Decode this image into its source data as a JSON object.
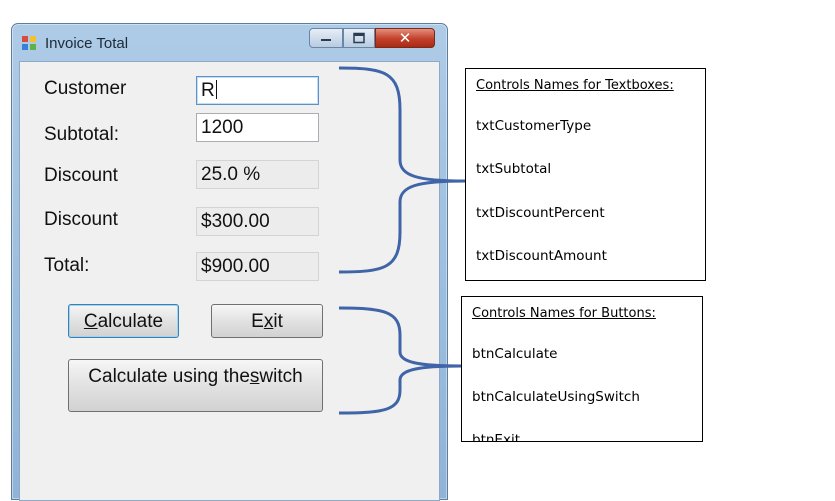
{
  "window": {
    "title": "Invoice Total",
    "close_glyph": "✕"
  },
  "form": {
    "customer_label": "Customer",
    "customer_value": "R",
    "subtotal_label": "Subtotal:",
    "subtotal_value": "1200",
    "discount_percent_label": "Discount",
    "discount_percent_value": "25.0 %",
    "discount_amount_label": "Discount",
    "discount_amount_value": "$300.00",
    "total_label": "Total:",
    "total_value": "$900.00"
  },
  "buttons": {
    "calculate": {
      "mnemonic": "C",
      "rest": "alculate"
    },
    "exit": {
      "before": "E",
      "mnemonic": "x",
      "after": "it"
    },
    "switch": {
      "before": "Calculate using the ",
      "mnemonic": "s",
      "after": "witch"
    }
  },
  "notes": {
    "textboxes": {
      "heading": "Controls Names for Textboxes:",
      "items": [
        "txtCustomerType",
        "txtSubtotal",
        "txtDiscountPercent",
        "txtDiscountAmount"
      ]
    },
    "buttons": {
      "heading": "Controls Names for Buttons:",
      "items": [
        "btnCalculate",
        "btnCalculateUsingSwitch",
        "btnExit"
      ]
    }
  },
  "colors": {
    "brace": "#3f64a8",
    "window_frame": "#aecbe6",
    "close_button": "#c3402a"
  },
  "icons": [
    "app-icon",
    "minimize-icon",
    "maximize-icon",
    "close-icon"
  ]
}
